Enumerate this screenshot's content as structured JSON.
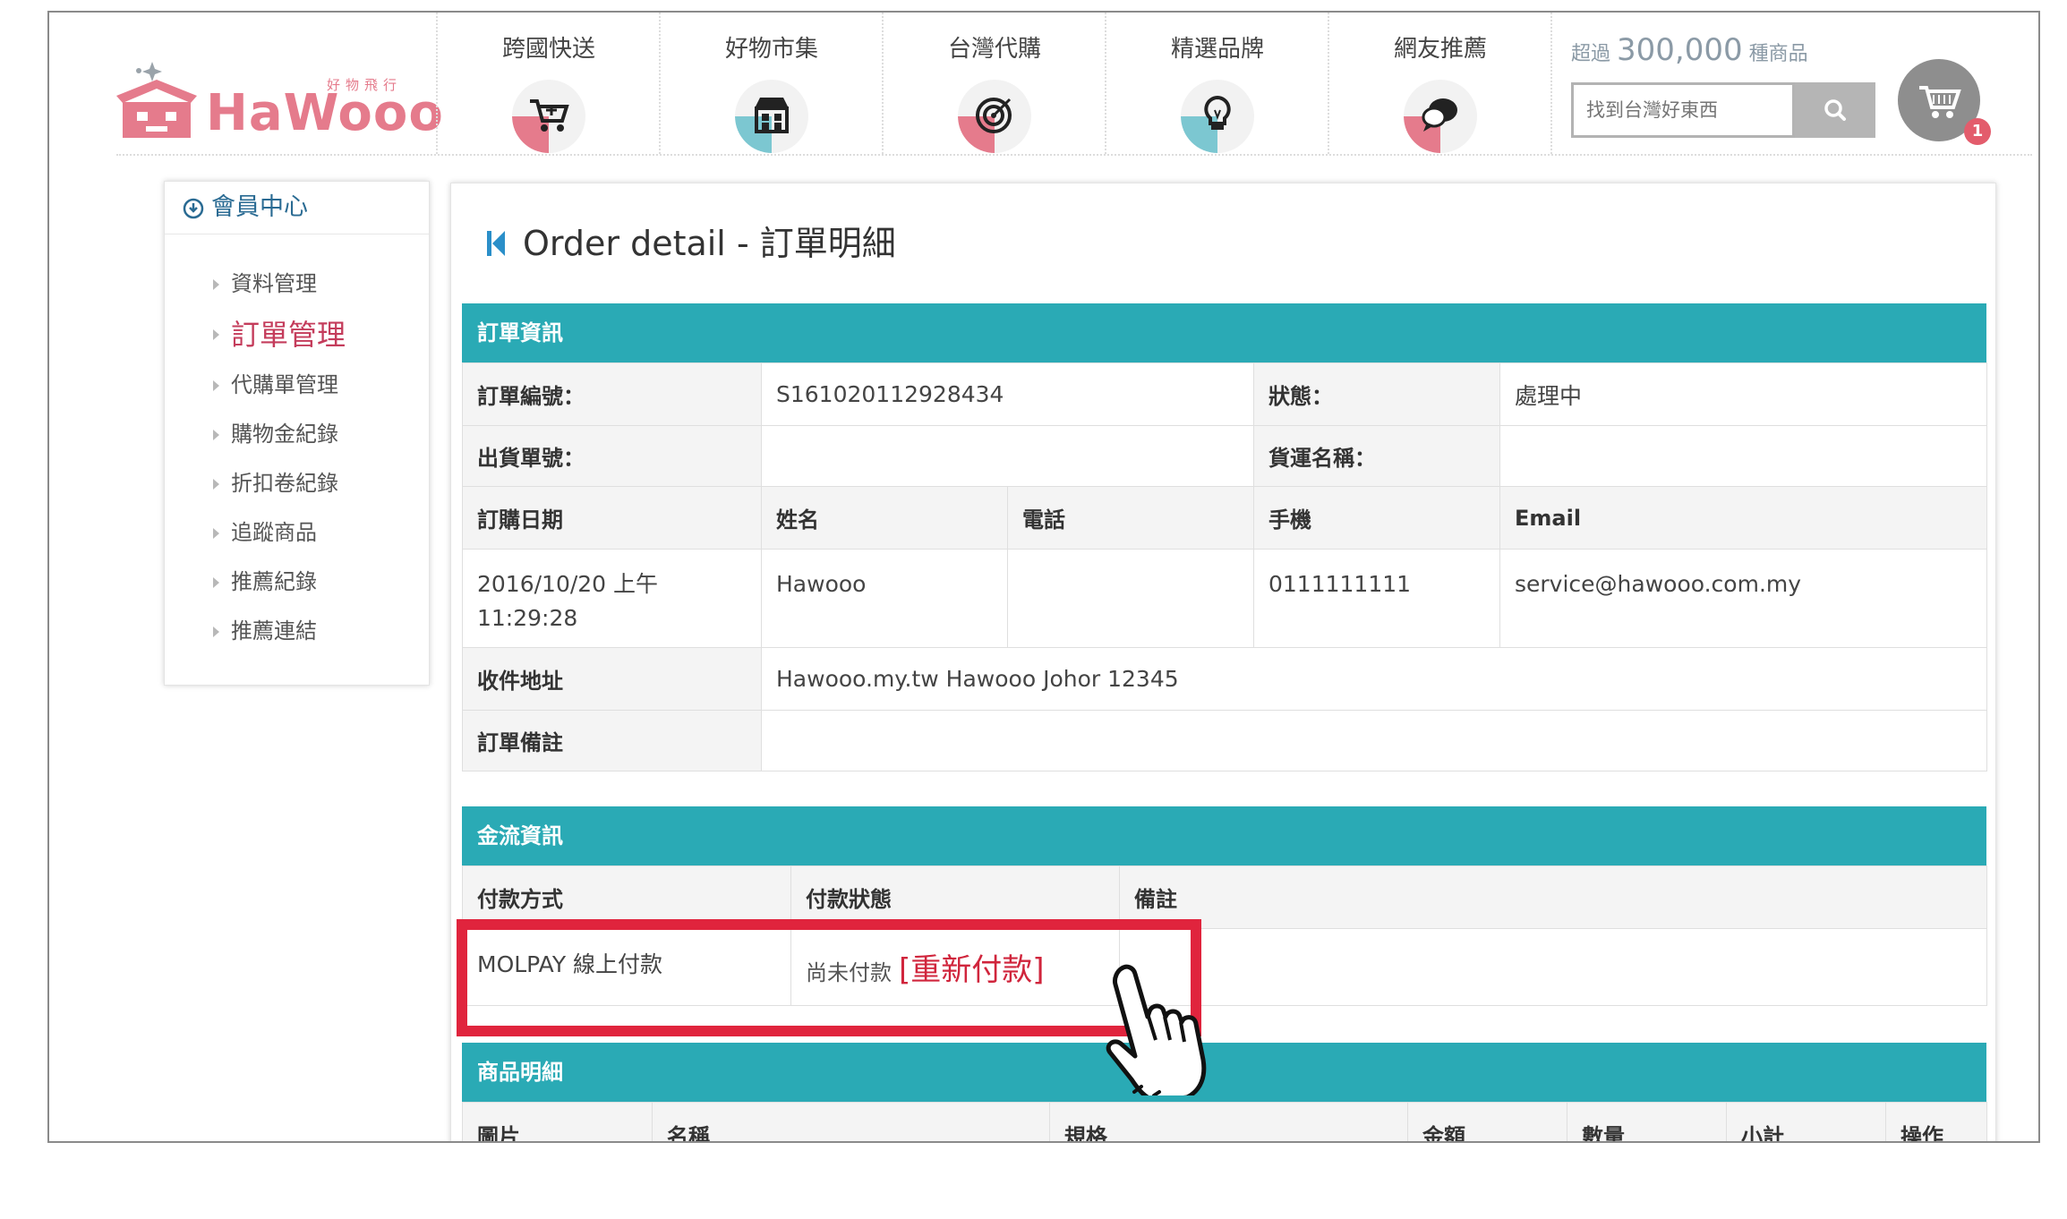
{
  "header": {
    "logo": {
      "text": "HaWooo",
      "subtitle": "好物飛行"
    },
    "nav": [
      {
        "label": "跨國快送",
        "icon": "shopping-cart-icon",
        "accent": "#e57b8c"
      },
      {
        "label": "好物市集",
        "icon": "storefront-icon",
        "accent": "#7cc7d1"
      },
      {
        "label": "台灣代購",
        "icon": "target-icon",
        "accent": "#e57b8c"
      },
      {
        "label": "精選品牌",
        "icon": "lightbulb-icon",
        "accent": "#7cc7d1"
      },
      {
        "label": "網友推薦",
        "icon": "speech-bubble-icon",
        "accent": "#e57b8c"
      }
    ],
    "counter": {
      "prefix": "超過",
      "count": "300,000",
      "suffix": "種商品"
    },
    "search_placeholder": "找到台灣好東西",
    "cart_count": "1"
  },
  "sidebar": {
    "title": "會員中心",
    "items": [
      {
        "label": "資料管理",
        "active": false
      },
      {
        "label": "訂單管理",
        "active": true
      },
      {
        "label": "代購單管理",
        "active": false
      },
      {
        "label": "購物金紀錄",
        "active": false
      },
      {
        "label": "折扣卷紀錄",
        "active": false
      },
      {
        "label": "追蹤商品",
        "active": false
      },
      {
        "label": "推薦紀錄",
        "active": false
      },
      {
        "label": "推薦連結",
        "active": false
      }
    ]
  },
  "main": {
    "title": "Order detail - 訂單明細",
    "order_info": {
      "heading": "訂單資訊",
      "order_no_label": "訂單編號：",
      "order_no": "S161020112928434",
      "status_label": "狀態：",
      "status": "處理中",
      "shipment_no_label": "出貨單號：",
      "shipment_no": "",
      "carrier_label": "貨運名稱：",
      "carrier": "",
      "col_date": "訂購日期",
      "col_name": "姓名",
      "col_phone": "電話",
      "col_mobile": "手機",
      "col_email": "Email",
      "date_line1": "2016/10/20 上午",
      "date_line2": "11:29:28",
      "name": "Hawooo",
      "phone": "",
      "mobile": "0111111111",
      "email": "service@hawooo.com.my",
      "address_label": "收件地址",
      "address": "Hawooo.my.tw Hawooo Johor 12345",
      "remark_label": "訂單備註",
      "remark": ""
    },
    "payment": {
      "heading": "金流資訊",
      "col_method": "付款方式",
      "col_status": "付款狀態",
      "col_note": "備註",
      "method": "MOLPAY 線上付款",
      "status": "尚未付款",
      "retry_link": "[重新付款]",
      "note": ""
    },
    "products": {
      "heading": "商品明細",
      "columns": [
        "圖片",
        "名稱",
        "規格",
        "金額",
        "數量",
        "小計",
        "操作"
      ]
    }
  }
}
